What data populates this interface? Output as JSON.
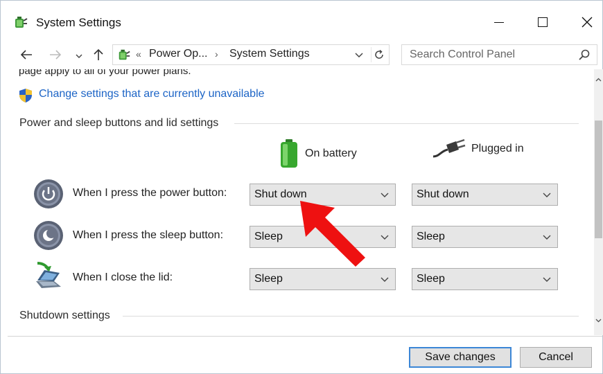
{
  "window": {
    "title": "System Settings",
    "icon": "power-options-icon"
  },
  "address_bar": {
    "prefix": "«",
    "crumbs": [
      "Power Op...",
      "System Settings"
    ],
    "chevron": "›"
  },
  "search": {
    "placeholder": "Search Control Panel"
  },
  "content": {
    "cut_text": "page apply to all of your power plans.",
    "change_link": "Change settings that are currently unavailable",
    "section_power": "Power and sleep buttons and lid settings",
    "col_battery": "On battery",
    "col_plugged": "Plugged in",
    "rows": [
      {
        "label": "When I press the power button:",
        "battery": "Shut down",
        "plugged": "Shut down",
        "icon": "power-button-icon"
      },
      {
        "label": "When I press the sleep button:",
        "battery": "Sleep",
        "plugged": "Sleep",
        "icon": "sleep-button-icon"
      },
      {
        "label": "When I close the lid:",
        "battery": "Sleep",
        "plugged": "Sleep",
        "icon": "laptop-lid-icon"
      }
    ],
    "section_shutdown": "Shutdown settings"
  },
  "footer": {
    "save": "Save changes",
    "cancel": "Cancel"
  },
  "colors": {
    "link": "#1c64c6",
    "focus_border": "#3b86d6",
    "annotation_arrow": "#ee1111"
  }
}
